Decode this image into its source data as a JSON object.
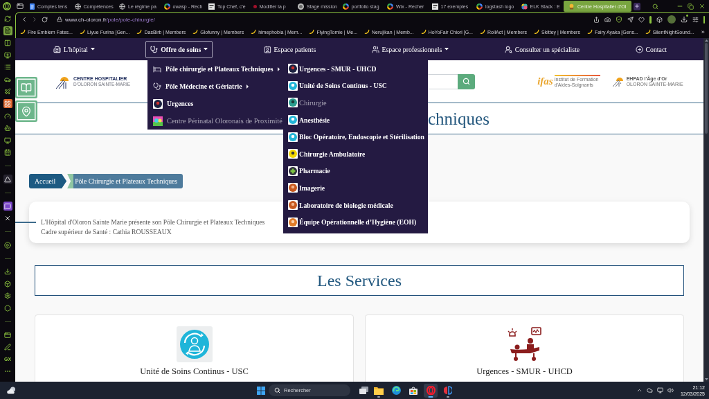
{
  "browser": {
    "tabs": [
      {
        "title": "Comptes tens",
        "selected": false
      },
      {
        "title": "Compétences",
        "selected": false
      },
      {
        "title": "Le régime pa",
        "selected": false
      },
      {
        "title": "owasp - Rech",
        "selected": false
      },
      {
        "title": "Top Chef, c'e",
        "selected": false
      },
      {
        "title": "Modifier la p",
        "selected": false
      },
      {
        "title": "Stage mission",
        "selected": false
      },
      {
        "title": "portfolio stag",
        "selected": false
      },
      {
        "title": "Wix - Recher",
        "selected": false
      },
      {
        "title": "17 exemples",
        "selected": false
      },
      {
        "title": "logstash logo",
        "selected": false
      },
      {
        "title": "ELK Stack : E",
        "selected": false
      },
      {
        "title": "Centre Hospitalier d'Ol",
        "selected": true
      }
    ],
    "address": {
      "domain": "www.ch-oloron.fr",
      "path": "/pole/pole-chirurgie/"
    },
    "bookmarks": [
      "Fire Emblem Fates...",
      "Liyue Furina [Gen...",
      "DasBirb | Members",
      "Glofunny | Members",
      "himephobia | Mem...",
      "FlyingTomie | Me...",
      "Nerujikan | Memb...",
      "HoYoFair Chiori [G...",
      "RollAct | Members",
      "Skittey | Members",
      "Fairy Ayaka [Gens...",
      "SilentNightSound..."
    ],
    "bookmarks_more": "»",
    "sidebar": [
      {
        "selected": false
      },
      {
        "selected": true
      },
      {
        "selected": false
      },
      {
        "selected": false
      },
      {
        "selected": false
      },
      {
        "selected": false
      },
      {
        "selected": false
      },
      {
        "selected": false
      },
      {
        "selected": false
      },
      {
        "selected": false
      },
      {
        "selected": false
      },
      {
        "selected": false
      },
      {
        "selected": false
      },
      {
        "selected": false
      },
      {
        "selected": false
      },
      {
        "selected": false
      },
      {
        "selected": false
      },
      {
        "selected": false
      },
      {
        "selected": false
      },
      {
        "selected": false
      },
      {
        "selected": false
      },
      {
        "selected": false
      },
      {
        "selected": false,
        "label": "GX"
      },
      {
        "selected": false
      }
    ]
  },
  "site": {
    "nav": [
      {
        "label": "L'hôpital",
        "expandable": true,
        "selected": false
      },
      {
        "label": "Offre de soins",
        "expandable": true,
        "selected": true
      },
      {
        "label": "Espace patients",
        "expandable": false,
        "selected": false
      },
      {
        "label": "Espace professionnels",
        "expandable": true,
        "selected": false
      },
      {
        "label": "Consulter un spécialiste",
        "expandable": false,
        "selected": false
      },
      {
        "label": "Contact",
        "expandable": false,
        "selected": false
      }
    ],
    "menu": [
      {
        "label": "Pôle chirurgie et Plateaux Techniques",
        "expandable": true,
        "dimmed": false
      },
      {
        "label": "Pôle Médecine et Gériatrie",
        "expandable": true,
        "dimmed": false
      },
      {
        "label": "Urgences",
        "expandable": false,
        "dimmed": false
      },
      {
        "label": "Centre Périnatal Oloronais de Proximité",
        "expandable": false,
        "dimmed": true
      }
    ],
    "submenu": [
      {
        "label": "Urgences - SMUR - UHCD",
        "dimmed": false
      },
      {
        "label": "Unité de Soins Continus - USC",
        "dimmed": false
      },
      {
        "label": "Chirurgie",
        "dimmed": true
      },
      {
        "label": "Anesthésie",
        "dimmed": false
      },
      {
        "label": "Bloc Opératoire, Endoscopie et Stérilisation",
        "dimmed": false
      },
      {
        "label": "Chirurgie Ambulatoire",
        "dimmed": false
      },
      {
        "label": "Pharmacie",
        "dimmed": false
      },
      {
        "label": "Imagerie",
        "dimmed": false
      },
      {
        "label": "Laboratoire de biologie médicale",
        "dimmed": false
      },
      {
        "label": "Équipe Opérationnelle d’Hygiène (EOH)",
        "dimmed": false
      }
    ],
    "logo": {
      "title": "CENTRE HOSPITALIER",
      "subtitle": "D'OLORON SAINTE-MARIE"
    },
    "partner_logos": [
      {
        "name": "ifas",
        "caption": "Institut de Formation d'Aides-Soignants"
      },
      {
        "name": "EHPAD l'Âge d'Or",
        "caption": "OLORON SAINTE-MARIE"
      }
    ],
    "title": "chniques",
    "breadcrumb": [
      {
        "label": "Accueil",
        "selected": false
      },
      {
        "label": "Pôle Chirurgie et Plateaux Techniques",
        "selected": true
      }
    ],
    "intro": [
      "L'Hôpital d'Oloron Sainte Marie présente son Pôle Chirurgie et Plateaux Techniques",
      "Cadre supérieur de Santé : Cathia ROUSSEAUX"
    ],
    "services_heading": "Les Services",
    "services": [
      {
        "title": "Unité de Soins Continus - USC"
      },
      {
        "title": "Urgences - SMUR - UHCD"
      }
    ]
  },
  "taskbar": {
    "search_placeholder": "Rechercher",
    "apps": [
      {
        "running": true,
        "selected": false
      },
      {
        "running": false,
        "selected": false
      },
      {
        "running": false,
        "selected": false
      },
      {
        "running": true,
        "selected": true
      },
      {
        "running": true,
        "selected": false
      }
    ],
    "time": "21:12",
    "date": "12/03/2025"
  }
}
